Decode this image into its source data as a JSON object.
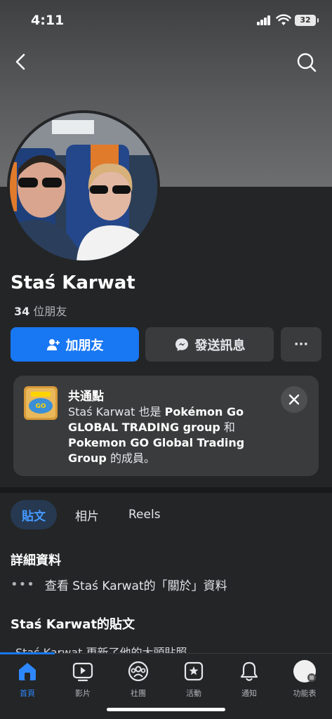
{
  "status": {
    "time": "4:11",
    "battery": "32"
  },
  "profile": {
    "name": "Staś Karwat",
    "friends_count": "34",
    "friends_label": "位朋友"
  },
  "actions": {
    "add_friend": "加朋友",
    "send_message": "發送訊息",
    "more": "···"
  },
  "common": {
    "title": "共通點",
    "t1": "Staś Karwat 也是 ",
    "group1": "Pokémon Go GLOBAL TRADING group",
    "t2": " 和 ",
    "group2": "Pokemon GO Global Trading Group",
    "t3": " 的成員。"
  },
  "tabs": [
    {
      "label": "貼文"
    },
    {
      "label": "相片"
    },
    {
      "label": "Reels"
    }
  ],
  "details": {
    "title": "詳細資料",
    "about_link": "查看 Staś Karwat的「關於」資料"
  },
  "posts": {
    "title": "Staś Karwat的貼文",
    "peek": "Staś Karwat 更新了他的大頭貼照。"
  },
  "tabbar": [
    {
      "label": "首頁",
      "icon": "home-icon"
    },
    {
      "label": "影片",
      "icon": "video-icon"
    },
    {
      "label": "社團",
      "icon": "groups-icon"
    },
    {
      "label": "活動",
      "icon": "events-icon"
    },
    {
      "label": "通知",
      "icon": "bell-icon"
    },
    {
      "label": "功能表",
      "icon": "menu-icon"
    }
  ],
  "colors": {
    "accent": "#1877f2",
    "background": "#242526",
    "card": "#3a3b3c"
  }
}
